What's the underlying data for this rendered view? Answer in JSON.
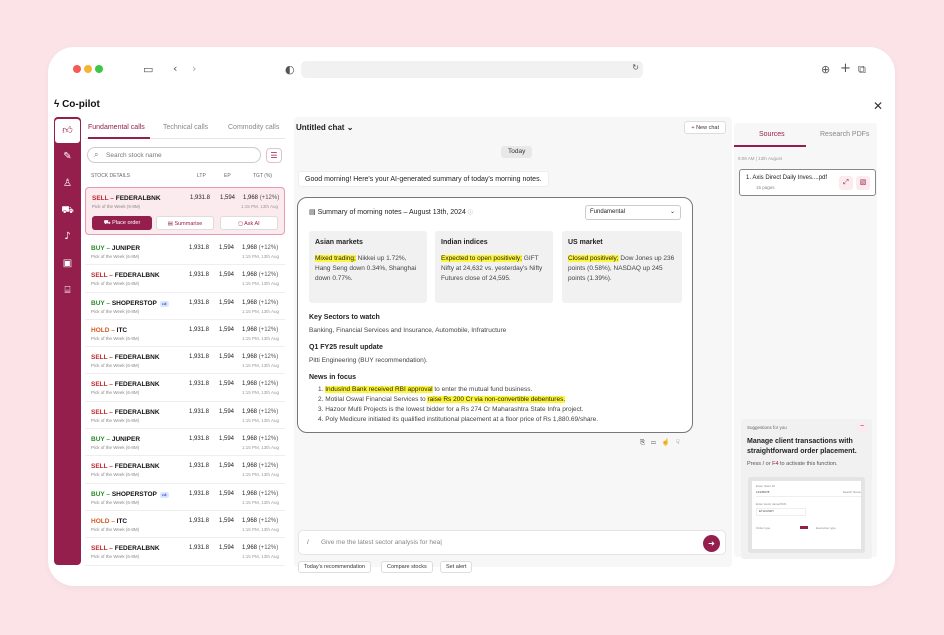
{
  "app": {
    "title": "Co-pilot"
  },
  "left": {
    "tabs": [
      "Fundamental calls",
      "Technical calls",
      "Commodity calls"
    ],
    "search_placeholder": "Search stock name",
    "headers": [
      "STOCK DETAILS",
      "LTP",
      "EP",
      "TGT (%)"
    ],
    "rows": [
      {
        "action": "SELL",
        "name": "FEDERALBNK",
        "sub": "Pick of the Week (6-8M)",
        "ltp": "1,931.8",
        "ep": "1,594",
        "tgt": "1,968",
        "pct": "(+12%)",
        "time": "1:15 PM, 13th Aug",
        "selected": true,
        "like": false
      },
      {
        "action": "BUY",
        "name": "JUNIPER",
        "sub": "Pick of the Week (6-8M)",
        "ltp": "1,931.8",
        "ep": "1,594",
        "tgt": "1,968",
        "pct": "(+12%)",
        "time": "1:15 PM, 13th Aug",
        "like": false
      },
      {
        "action": "SELL",
        "name": "FEDERALBNK",
        "sub": "Pick of the Week (6-8M)",
        "ltp": "1,931.8",
        "ep": "1,594",
        "tgt": "1,968",
        "pct": "(+12%)",
        "time": "1:15 PM, 13th Aug",
        "like": false
      },
      {
        "action": "BUY",
        "name": "SHOPERSTOP",
        "sub": "Pick of the Week (6-8M)",
        "ltp": "1,931.8",
        "ep": "1,594",
        "tgt": "1,968",
        "pct": "(+12%)",
        "time": "1:15 PM, 13th Aug",
        "like": true
      },
      {
        "action": "HOLD",
        "name": "ITC",
        "sub": "Pick of the Week (6-8M)",
        "ltp": "1,931.8",
        "ep": "1,594",
        "tgt": "1,968",
        "pct": "(+12%)",
        "time": "1:15 PM, 13th Aug",
        "like": false
      },
      {
        "action": "SELL",
        "name": "FEDERALBNK",
        "sub": "Pick of the Week (6-8M)",
        "ltp": "1,931.8",
        "ep": "1,594",
        "tgt": "1,968",
        "pct": "(+12%)",
        "time": "1:15 PM, 13th Aug",
        "like": false
      },
      {
        "action": "SELL",
        "name": "FEDERALBNK",
        "sub": "Pick of the Week (6-8M)",
        "ltp": "1,931.8",
        "ep": "1,594",
        "tgt": "1,968",
        "pct": "(+12%)",
        "time": "1:15 PM, 13th Aug",
        "like": false
      },
      {
        "action": "SELL",
        "name": "FEDERALBNK",
        "sub": "Pick of the Week (6-8M)",
        "ltp": "1,931.8",
        "ep": "1,594",
        "tgt": "1,968",
        "pct": "(+12%)",
        "time": "1:15 PM, 13th Aug",
        "like": false
      },
      {
        "action": "BUY",
        "name": "JUNIPER",
        "sub": "Pick of the Week (6-8M)",
        "ltp": "1,931.8",
        "ep": "1,594",
        "tgt": "1,968",
        "pct": "(+12%)",
        "time": "1:15 PM, 13th Aug",
        "like": false
      },
      {
        "action": "SELL",
        "name": "FEDERALBNK",
        "sub": "Pick of the Week (6-8M)",
        "ltp": "1,931.8",
        "ep": "1,594",
        "tgt": "1,968",
        "pct": "(+12%)",
        "time": "1:15 PM, 13th Aug",
        "like": false
      },
      {
        "action": "BUY",
        "name": "SHOPERSTOP",
        "sub": "Pick of the Week (6-8M)",
        "ltp": "1,931.8",
        "ep": "1,594",
        "tgt": "1,968",
        "pct": "(+12%)",
        "time": "1:15 PM, 13th Aug",
        "like": true
      },
      {
        "action": "HOLD",
        "name": "ITC",
        "sub": "Pick of the Week (6-8M)",
        "ltp": "1,931.8",
        "ep": "1,594",
        "tgt": "1,968",
        "pct": "(+12%)",
        "time": "1:15 PM, 13th Aug",
        "like": false
      },
      {
        "action": "SELL",
        "name": "FEDERALBNK",
        "sub": "Pick of the Week (6-8M)",
        "ltp": "1,931.8",
        "ep": "1,594",
        "tgt": "1,968",
        "pct": "(+12%)",
        "time": "1:15 PM, 13th Aug",
        "like": false
      }
    ],
    "sel_buttons": [
      "Place order",
      "Summarise",
      "Ask AI"
    ]
  },
  "chat": {
    "title": "Untitled chat",
    "new_chat": "New chat",
    "today": "Today",
    "greeting": "Good morning! Here's your AI-generated summary of today's morning notes.",
    "card_title": "Summary of morning notes – August 13th, 2024",
    "dropdown": "Fundamental",
    "boxes": [
      {
        "h": "Asian markets",
        "hl": "Mixed trading;",
        "t": " Nikkei up 1.72%, Hang Seng down 0.34%, Shanghai down 0.77%."
      },
      {
        "h": "Indian indices",
        "hl": "Expected to open positively;",
        "t": " GIFT Nifty at 24,632 vs. yesterday's Nifty Futures close of 24,595."
      },
      {
        "h": "US market",
        "hl": "Closed positively;",
        "t": " Dow Jones up 236 points (0.58%), NASDAQ up 245 points (1.39%)."
      }
    ],
    "key_h": "Key Sectors to watch",
    "key_t": "Banking, Financial Services and Insurance, Automobile, Infratructure",
    "q1_h": "Q1 FY25 result update",
    "q1_t": "Pitti Engineering (BUY recommendation).",
    "news_h": "News in focus",
    "chips": [
      "Today's recommendation",
      "Compare stocks",
      "Set alert"
    ],
    "input": "Give me the latest sector analysis for hea|"
  },
  "right": {
    "tabs": [
      "Sources",
      "Research PDFs"
    ],
    "date": "9:08 AM | 13th August",
    "pdf_name": "1.  Axis Direct Daily Inves....pdf",
    "pdf_pages": "15 pages",
    "sug_label": "Suggestions for you",
    "sug_title": "Manage client transactions with straightforward order placement.",
    "sug_press": "Press",
    "sug_key1": "/",
    "sug_or": "or",
    "sug_key2": "F4",
    "sug_rest": "to activate this function.",
    "mock_labels": [
      "Enter client ID",
      "12345678",
      "Search Name",
      "Enter stock name/ISIN",
      "ETH/USDT",
      "Order type",
      "Execution type"
    ]
  },
  "colors": {
    "brand": "#951f4c"
  }
}
